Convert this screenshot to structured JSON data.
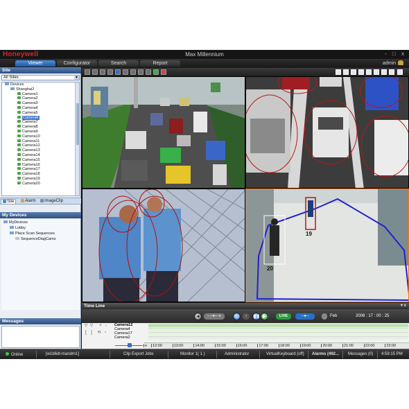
{
  "app": {
    "brand": "Honeywell",
    "title": "Max Millennium",
    "window_controls": "- □ x",
    "user": "admin"
  },
  "tabs": [
    {
      "label": "Viewer",
      "active": true
    },
    {
      "label": "Configurator",
      "active": false
    },
    {
      "label": "Search",
      "active": false
    },
    {
      "label": "Report",
      "active": false
    }
  ],
  "site_panel": {
    "title": "Site",
    "filter": "All Sites",
    "root": "Devices",
    "group": "Shanghai2",
    "cameras": [
      "Camera1",
      "Camera2",
      "Camera3",
      "Camera4",
      "Camera5",
      "Camera6",
      "Camera7",
      "Camera8",
      "Camera9",
      "Camera10",
      "Camera11",
      "Camera12",
      "Camera13",
      "Camera14",
      "Camera15",
      "Camera16",
      "Camera17",
      "Camera18",
      "Camera19",
      "Camera20"
    ],
    "selected_camera": "Camera6"
  },
  "panel_tabs": [
    "Site",
    "Alarm",
    "ImageClip"
  ],
  "my_devices": {
    "title": "My Devices",
    "root": "MyDevices",
    "items": [
      "Lobby",
      "Place Scan Sequences",
      "SequenceDiagCams"
    ]
  },
  "messages": {
    "title": "Messages"
  },
  "overlays": {
    "tile4_person_a": "20",
    "tile4_person_b": "19"
  },
  "timeline": {
    "title": "Time Line",
    "live": "LIVE",
    "month": "Feb",
    "time": "2008 : 17 : 00 : 25",
    "cameras": [
      "Camera12",
      "Camera4",
      "Camera17",
      "Camera2"
    ],
    "ticks": [
      "12:00",
      "13:00",
      "14:00",
      "15:00",
      "16:00",
      "17:00",
      "18:00",
      "19:00",
      "20:00",
      "21:00",
      "22:00",
      "23:00"
    ]
  },
  "status": {
    "online": "Online",
    "host": "[w1b6dt-mandm1]",
    "clip": "Clip Export Jobs",
    "monitor": "Monitor 1( 1 )",
    "role": "Administrator",
    "vkb": "VirtualKeyboard (off)",
    "alarms": "Alarms (492...",
    "messages": "Messages (0)",
    "clock": "4:59:15 PM"
  },
  "colors": {
    "brand_red": "#d8262e",
    "tab_active": "#2f6ec0",
    "tile_selected": "#ff6d1a",
    "overlay_box": "#2020d0"
  }
}
